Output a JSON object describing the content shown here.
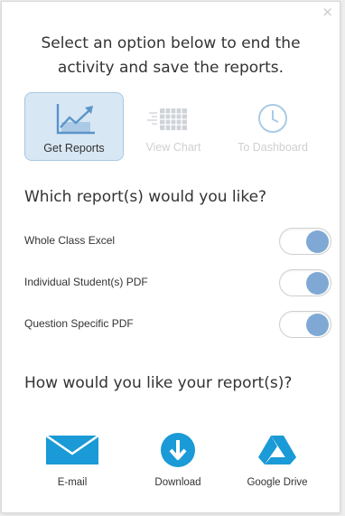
{
  "dialog": {
    "close_symbol": "×",
    "heading_line1": "Select an option below to end the",
    "heading_line2": "activity and save the reports."
  },
  "options": [
    {
      "label": "Get Reports",
      "icon": "line-chart-icon",
      "state": "selected"
    },
    {
      "label": "View Chart",
      "icon": "grid-chart-icon",
      "state": "disabled"
    },
    {
      "label": "To Dashboard",
      "icon": "clock-icon",
      "state": "disabled"
    }
  ],
  "reports": {
    "title": "Which report(s) would you like?",
    "items": [
      {
        "label": "Whole Class Excel",
        "on": true
      },
      {
        "label": "Individual Student(s) PDF",
        "on": true
      },
      {
        "label": "Question Specific PDF",
        "on": true
      }
    ]
  },
  "delivery": {
    "title": "How would you like your report(s)?",
    "items": [
      {
        "label": "E-mail",
        "icon": "envelope-icon"
      },
      {
        "label": "Download",
        "icon": "download-icon"
      },
      {
        "label": "Google Drive",
        "icon": "google-drive-icon"
      }
    ]
  },
  "colors": {
    "accent": "#1a9ad6",
    "toggle_knob": "#7fa9d4",
    "selected_bg": "#d8e7f4",
    "disabled_text": "#d0d0d0"
  }
}
